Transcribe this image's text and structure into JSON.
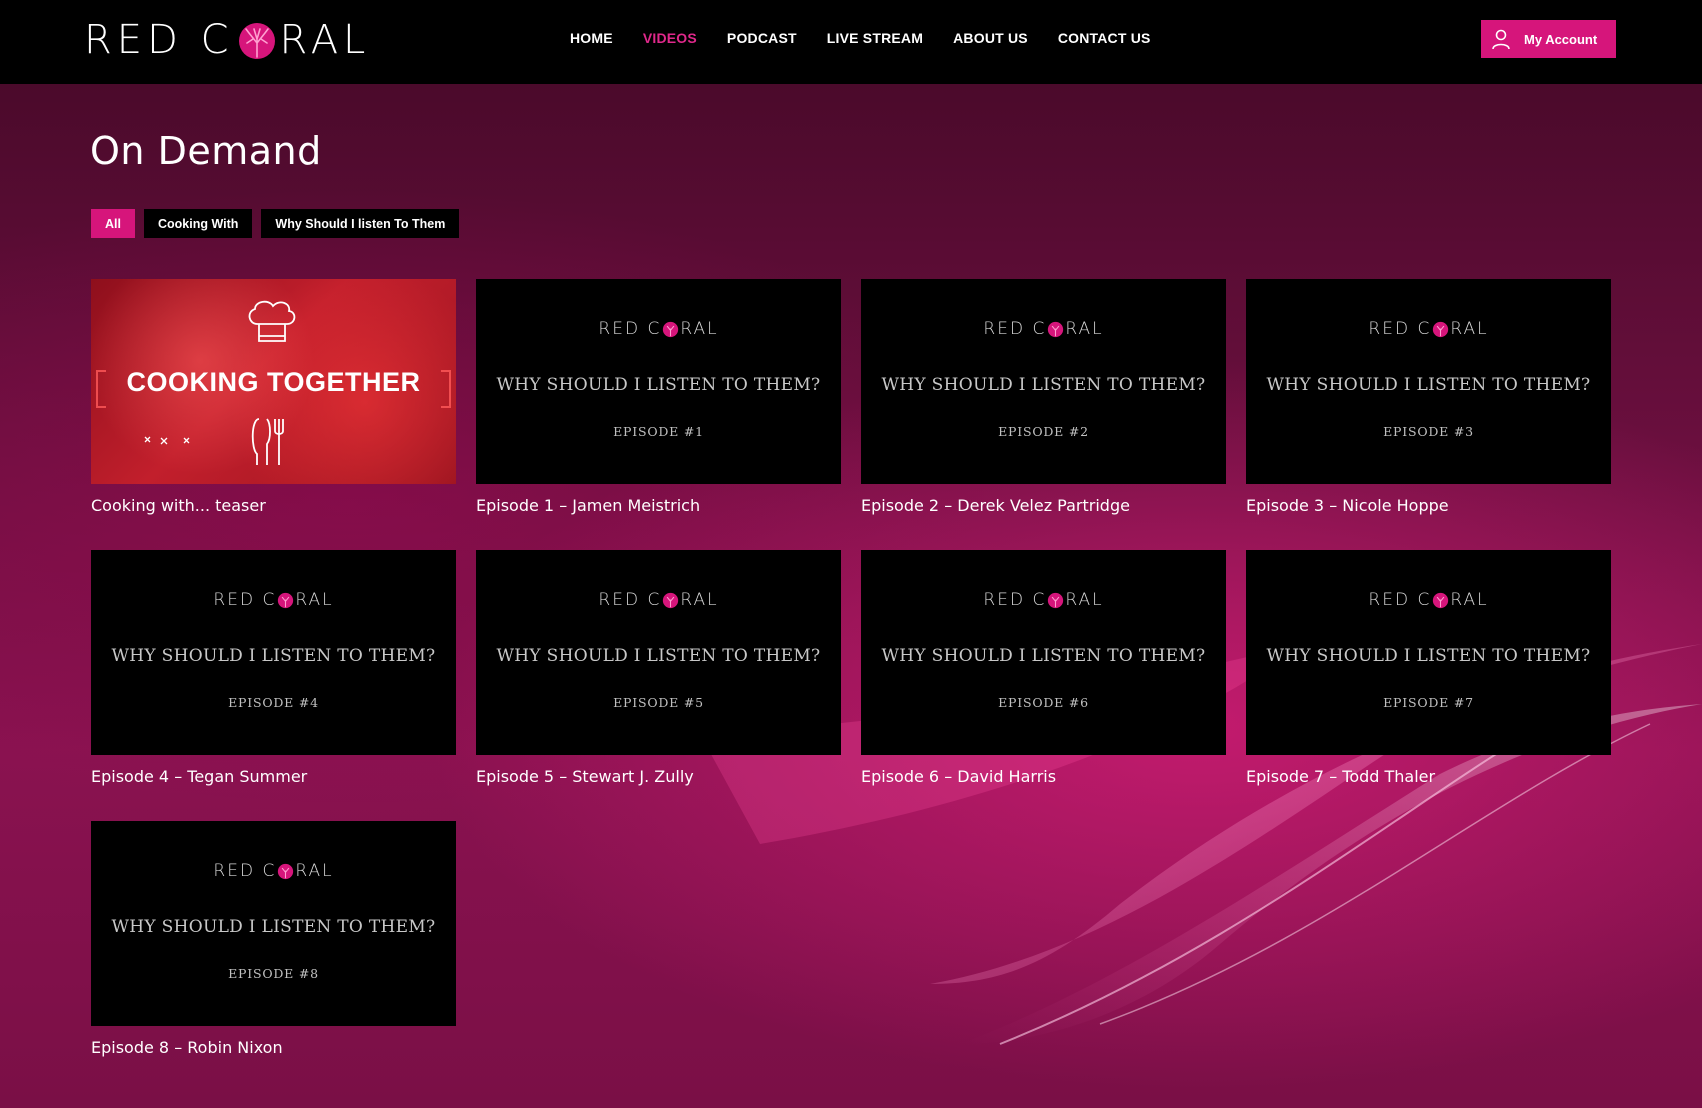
{
  "brand": {
    "name_left": "RED C",
    "name_right": "RAL",
    "accent": "#d6157b"
  },
  "nav": {
    "items": [
      {
        "label": "HOME",
        "active": false
      },
      {
        "label": "VIDEOS",
        "active": true
      },
      {
        "label": "PODCAST",
        "active": false
      },
      {
        "label": "LIVE STREAM",
        "active": false
      },
      {
        "label": "ABOUT US",
        "active": false
      },
      {
        "label": "CONTACT US",
        "active": false
      }
    ]
  },
  "account": {
    "label": "My Account",
    "icon": "user-icon"
  },
  "page": {
    "title": "On Demand"
  },
  "filters": [
    {
      "label": "All",
      "active": true
    },
    {
      "label": "Cooking With",
      "active": false
    },
    {
      "label": "Why Should I listen To Them",
      "active": false
    }
  ],
  "videos": [
    {
      "title": "Cooking with... teaser",
      "thumb": {
        "kind": "cooking",
        "headline": "COOKING TOGETHER"
      }
    },
    {
      "title": "Episode 1 – Jamen Meistrich",
      "thumb": {
        "kind": "episode",
        "logo": "RED C RAL",
        "headline": "WHY SHOULD I LISTEN TO THEM?",
        "episode": "EPISODE #1"
      }
    },
    {
      "title": "Episode 2 – Derek Velez Partridge",
      "thumb": {
        "kind": "episode",
        "logo": "RED C RAL",
        "headline": "WHY SHOULD I LISTEN TO THEM?",
        "episode": "EPISODE #2"
      }
    },
    {
      "title": "Episode 3 – Nicole Hoppe",
      "thumb": {
        "kind": "episode",
        "logo": "RED C RAL",
        "headline": "WHY SHOULD I LISTEN TO THEM?",
        "episode": "EPISODE #3"
      }
    },
    {
      "title": "Episode 4 – Tegan Summer",
      "thumb": {
        "kind": "episode",
        "logo": "RED C RAL",
        "headline": "WHY SHOULD I LISTEN TO THEM?",
        "episode": "EPISODE #4"
      }
    },
    {
      "title": "Episode 5 – Stewart J. Zully",
      "thumb": {
        "kind": "episode",
        "logo": "RED C RAL",
        "headline": "WHY SHOULD I LISTEN TO THEM?",
        "episode": "EPISODE #5"
      }
    },
    {
      "title": "Episode 6 – David Harris",
      "thumb": {
        "kind": "episode",
        "logo": "RED C RAL",
        "headline": "WHY SHOULD I LISTEN TO THEM?",
        "episode": "EPISODE #6"
      }
    },
    {
      "title": "Episode 7 – Todd Thaler",
      "thumb": {
        "kind": "episode",
        "logo": "RED C RAL",
        "headline": "WHY SHOULD I LISTEN TO THEM?",
        "episode": "EPISODE #7"
      }
    },
    {
      "title": "Episode 8 – Robin Nixon",
      "thumb": {
        "kind": "episode",
        "logo": "RED C RAL",
        "headline": "WHY SHOULD I LISTEN TO THEM?",
        "episode": "EPISODE #8"
      }
    }
  ]
}
